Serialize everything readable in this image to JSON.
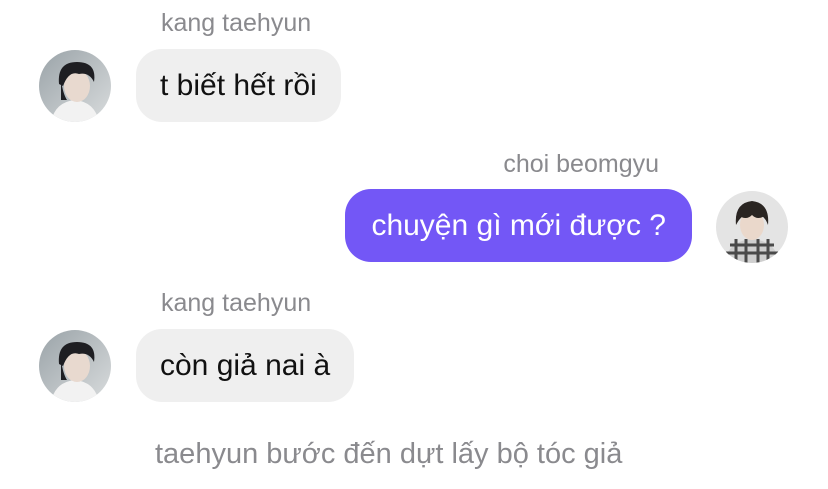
{
  "colors": {
    "incoming_bubble": "#efefef",
    "outgoing_bubble": "#7357f6",
    "sender_text": "#8a8a8e",
    "narration_text": "#8a8a8e"
  },
  "messages": [
    {
      "sender": "kang taehyun",
      "text": "t biết hết rồi",
      "direction": "incoming",
      "avatar_icon": "avatar-taehyun-photo"
    },
    {
      "sender": "choi beomgyu",
      "text": "chuyện gì mới được ?",
      "direction": "outgoing",
      "avatar_icon": "avatar-beomgyu-photo"
    },
    {
      "sender": "kang taehyun",
      "text": "còn giả nai à",
      "direction": "incoming",
      "avatar_icon": "avatar-taehyun-photo"
    }
  ],
  "narration": "taehyun bước đến dựt lấy bộ tóc giả"
}
